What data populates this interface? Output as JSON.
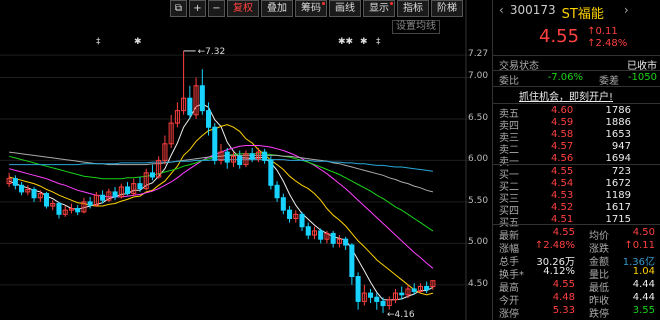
{
  "toolbar": {
    "buttons": [
      {
        "name": "export-button",
        "label": "⧉"
      },
      {
        "name": "zoom-in-button",
        "label": "+"
      },
      {
        "name": "zoom-out-button",
        "label": "−"
      },
      {
        "name": "adjust-button",
        "label": "复权",
        "active": true
      },
      {
        "name": "overlay-button",
        "label": "叠加"
      },
      {
        "name": "chips-button",
        "label": "筹码",
        "dot": true
      },
      {
        "name": "draw-button",
        "label": "画线"
      },
      {
        "name": "display-button",
        "label": "显示",
        "dot": true
      },
      {
        "name": "indicator-button",
        "label": "指标"
      },
      {
        "name": "ladder-button",
        "label": "阶梯"
      }
    ],
    "settings_label": "设置均线"
  },
  "price_axis": [
    "7.27",
    "7.00",
    "6.50",
    "6.00",
    "5.50",
    "5.00",
    "4.50"
  ],
  "annotations": {
    "high_label": "7.32",
    "low_label": "4.16",
    "markers": [
      "‡",
      "✱",
      "✱✱",
      "✱",
      "‡"
    ]
  },
  "stock": {
    "code": "300173",
    "name": "ST福能",
    "price": "4.55",
    "change": "↑0.11",
    "change_pct": "↑2.48%"
  },
  "trade_status": {
    "label": "交易状态",
    "value": "已收市"
  },
  "ratio": {
    "wei_bi_label": "委比",
    "wei_bi": "-7.06%",
    "wei_cha_label": "委差",
    "wei_cha": "-1050"
  },
  "promo": "抓住机会，即刻开户!",
  "asks": [
    {
      "label": "卖五",
      "price": "4.60",
      "vol": "1786"
    },
    {
      "label": "卖四",
      "price": "4.59",
      "vol": "1886"
    },
    {
      "label": "卖三",
      "price": "4.58",
      "vol": "1653"
    },
    {
      "label": "卖二",
      "price": "4.57",
      "vol": "947"
    },
    {
      "label": "卖一",
      "price": "4.56",
      "vol": "1694"
    }
  ],
  "bids": [
    {
      "label": "买一",
      "price": "4.55",
      "vol": "723"
    },
    {
      "label": "买二",
      "price": "4.54",
      "vol": "1672"
    },
    {
      "label": "买三",
      "price": "4.53",
      "vol": "1189"
    },
    {
      "label": "买四",
      "price": "4.52",
      "vol": "1617"
    },
    {
      "label": "买五",
      "price": "4.51",
      "vol": "1715"
    }
  ],
  "stats": [
    {
      "l1": "最新",
      "v1": "4.55",
      "c1": "red",
      "l2": "均价",
      "v2": "4.50",
      "c2": "red"
    },
    {
      "l1": "涨幅",
      "v1": "↑2.48%",
      "c1": "red",
      "l2": "涨跌",
      "v2": "↑0.11",
      "c2": "red"
    },
    {
      "l1": "总手",
      "v1": "30.26万",
      "c1": "white",
      "l2": "金额",
      "v2": "1.36亿",
      "c2": "cyan"
    },
    {
      "l1": "换手*",
      "v1": "4.12%",
      "c1": "white",
      "l2": "量比",
      "v2": "1.04",
      "c2": "yellow"
    },
    {
      "l1": "最高",
      "v1": "4.55",
      "c1": "red",
      "l2": "最低",
      "v2": "4.44",
      "c2": "white"
    },
    {
      "l1": "今开",
      "v1": "4.48",
      "c1": "red",
      "l2": "昨收",
      "v2": "4.44",
      "c2": "white"
    },
    {
      "l1": "涨停",
      "v1": "5.33",
      "c1": "red",
      "l2": "跌停",
      "v2": "3.55",
      "c2": "green"
    }
  ],
  "colors": {
    "up": "#ff4040",
    "down": "#19d3ff",
    "ma5": "#f0f0f0",
    "ma10": "#ffd200",
    "ma20": "#ff40ff",
    "ma30": "#19d319",
    "ma60": "#aaaaaa",
    "ma120": "#2aa7d8"
  },
  "chart_data": {
    "type": "candlestick",
    "ylim": [
      4.1,
      7.5
    ],
    "candles": [
      [
        5.72,
        5.78,
        5.85,
        5.68
      ],
      [
        5.78,
        5.7,
        5.82,
        5.65
      ],
      [
        5.7,
        5.62,
        5.74,
        5.58
      ],
      [
        5.62,
        5.65,
        5.7,
        5.58
      ],
      [
        5.65,
        5.55,
        5.68,
        5.5
      ],
      [
        5.55,
        5.6,
        5.64,
        5.5
      ],
      [
        5.6,
        5.45,
        5.62,
        5.42
      ],
      [
        5.45,
        5.48,
        5.52,
        5.4
      ],
      [
        5.48,
        5.35,
        5.5,
        5.3
      ],
      [
        5.35,
        5.4,
        5.45,
        5.32
      ],
      [
        5.4,
        5.42,
        5.48,
        5.36
      ],
      [
        5.42,
        5.38,
        5.46,
        5.34
      ],
      [
        5.38,
        5.5,
        5.55,
        5.36
      ],
      [
        5.5,
        5.46,
        5.56,
        5.42
      ],
      [
        5.46,
        5.58,
        5.62,
        5.44
      ],
      [
        5.58,
        5.52,
        5.64,
        5.48
      ],
      [
        5.52,
        5.62,
        5.66,
        5.5
      ],
      [
        5.62,
        5.56,
        5.68,
        5.52
      ],
      [
        5.56,
        5.68,
        5.72,
        5.54
      ],
      [
        5.68,
        5.6,
        5.74,
        5.58
      ],
      [
        5.6,
        5.72,
        5.78,
        5.58
      ],
      [
        5.72,
        5.66,
        5.8,
        5.62
      ],
      [
        5.66,
        5.85,
        5.9,
        5.64
      ],
      [
        5.85,
        5.8,
        5.95,
        5.76
      ],
      [
        5.8,
        6.0,
        6.05,
        5.78
      ],
      [
        6.0,
        6.2,
        6.3,
        5.95
      ],
      [
        6.2,
        6.45,
        6.55,
        6.15
      ],
      [
        6.45,
        6.6,
        6.7,
        6.4
      ],
      [
        6.6,
        6.75,
        7.32,
        6.55
      ],
      [
        6.75,
        6.55,
        6.9,
        6.5
      ],
      [
        6.55,
        6.9,
        7.0,
        6.5
      ],
      [
        6.9,
        6.6,
        7.1,
        6.55
      ],
      [
        6.6,
        6.4,
        6.7,
        6.3
      ],
      [
        6.4,
        6.0,
        6.45,
        5.95
      ],
      [
        6.0,
        6.1,
        6.2,
        5.95
      ],
      [
        6.1,
        5.98,
        6.15,
        5.9
      ],
      [
        5.98,
        6.05,
        6.1,
        5.92
      ],
      [
        6.05,
        5.95,
        6.12,
        5.9
      ],
      [
        5.95,
        6.08,
        6.12,
        5.92
      ],
      [
        6.08,
        6.02,
        6.15,
        5.98
      ],
      [
        6.02,
        6.1,
        6.15,
        5.98
      ],
      [
        6.1,
        6.0,
        6.14,
        5.96
      ],
      [
        6.0,
        5.7,
        6.05,
        5.65
      ],
      [
        5.7,
        5.55,
        5.75,
        5.5
      ],
      [
        5.55,
        5.4,
        5.6,
        5.35
      ],
      [
        5.4,
        5.3,
        5.45,
        5.25
      ],
      [
        5.3,
        5.35,
        5.4,
        5.25
      ],
      [
        5.35,
        5.2,
        5.38,
        5.15
      ],
      [
        5.2,
        5.1,
        5.25,
        5.05
      ],
      [
        5.1,
        5.15,
        5.2,
        5.05
      ],
      [
        5.15,
        5.05,
        5.18,
        5.0
      ],
      [
        5.05,
        5.12,
        5.15,
        5.0
      ],
      [
        5.12,
        5.0,
        5.15,
        4.95
      ],
      [
        5.0,
        5.05,
        5.1,
        4.95
      ],
      [
        5.05,
        4.98,
        5.08,
        4.92
      ],
      [
        4.98,
        4.6,
        5.0,
        4.5
      ],
      [
        4.6,
        4.3,
        4.65,
        4.2
      ],
      [
        4.3,
        4.4,
        4.5,
        4.25
      ],
      [
        4.4,
        4.35,
        4.45,
        4.28
      ],
      [
        4.35,
        4.3,
        4.4,
        4.2
      ],
      [
        4.3,
        4.25,
        4.35,
        4.16
      ],
      [
        4.25,
        4.32,
        4.36,
        4.2
      ],
      [
        4.32,
        4.4,
        4.45,
        4.28
      ],
      [
        4.4,
        4.38,
        4.48,
        4.32
      ],
      [
        4.38,
        4.45,
        4.5,
        4.34
      ],
      [
        4.45,
        4.42,
        4.52,
        4.38
      ],
      [
        4.42,
        4.48,
        4.52,
        4.4
      ],
      [
        4.48,
        4.44,
        4.54,
        4.4
      ],
      [
        4.48,
        4.55,
        4.55,
        4.44
      ]
    ],
    "ma": [
      {
        "name": "ma5",
        "values": [
          5.75,
          5.72,
          5.69,
          5.67,
          5.64,
          5.62,
          5.57,
          5.54,
          5.49,
          5.46,
          5.42,
          5.41,
          5.43,
          5.45,
          5.47,
          5.49,
          5.54,
          5.56,
          5.59,
          5.6,
          5.64,
          5.64,
          5.7,
          5.73,
          5.81,
          5.9,
          6.06,
          6.21,
          6.4,
          6.51,
          6.65,
          6.68,
          6.64,
          6.49,
          6.41,
          6.22,
          6.11,
          6.03,
          6.03,
          6.02,
          6.04,
          6.03,
          5.97,
          5.88,
          5.75,
          5.59,
          5.46,
          5.36,
          5.29,
          5.22,
          5.16,
          5.12,
          5.08,
          5.06,
          5.04,
          4.93,
          4.8,
          4.67,
          4.53,
          4.41,
          4.32,
          4.32,
          4.32,
          4.33,
          4.36,
          4.39,
          4.43,
          4.43,
          4.47
        ]
      },
      {
        "name": "ma10",
        "values": [
          5.8,
          5.78,
          5.76,
          5.74,
          5.72,
          5.69,
          5.65,
          5.62,
          5.58,
          5.55,
          5.52,
          5.49,
          5.48,
          5.46,
          5.45,
          5.45,
          5.47,
          5.48,
          5.51,
          5.53,
          5.56,
          5.57,
          5.62,
          5.64,
          5.7,
          5.75,
          5.84,
          5.93,
          6.06,
          6.13,
          6.23,
          6.3,
          6.36,
          6.38,
          6.41,
          6.43,
          6.4,
          6.35,
          6.26,
          6.21,
          6.13,
          6.07,
          6.0,
          5.95,
          5.89,
          5.81,
          5.75,
          5.7,
          5.66,
          5.6,
          5.52,
          5.42,
          5.34,
          5.28,
          5.21,
          5.12,
          5.03,
          4.96,
          4.88,
          4.8,
          4.74,
          4.68,
          4.62,
          4.56,
          4.5,
          4.44,
          4.4,
          4.38,
          4.4
        ]
      },
      {
        "name": "ma20",
        "values": [
          5.9,
          5.88,
          5.86,
          5.84,
          5.82,
          5.8,
          5.78,
          5.75,
          5.72,
          5.7,
          5.67,
          5.64,
          5.62,
          5.6,
          5.58,
          5.57,
          5.56,
          5.56,
          5.56,
          5.57,
          5.58,
          5.59,
          5.61,
          5.63,
          5.66,
          5.7,
          5.74,
          5.79,
          5.85,
          5.9,
          5.95,
          6.0,
          6.04,
          6.07,
          6.1,
          6.13,
          6.15,
          6.17,
          6.18,
          6.18,
          6.18,
          6.17,
          6.16,
          6.14,
          6.12,
          6.09,
          6.06,
          6.02,
          5.98,
          5.94,
          5.89,
          5.84,
          5.78,
          5.72,
          5.66,
          5.59,
          5.52,
          5.45,
          5.38,
          5.31,
          5.24,
          5.17,
          5.1,
          5.03,
          4.96,
          4.89,
          4.83,
          4.76,
          4.7
        ]
      },
      {
        "name": "ma30",
        "values": [
          6.05,
          6.03,
          6.01,
          5.99,
          5.97,
          5.95,
          5.93,
          5.91,
          5.89,
          5.87,
          5.85,
          5.83,
          5.81,
          5.8,
          5.79,
          5.78,
          5.78,
          5.78,
          5.78,
          5.79,
          5.79,
          5.8,
          5.81,
          5.82,
          5.84,
          5.86,
          5.88,
          5.9,
          5.93,
          5.95,
          5.97,
          6.0,
          6.02,
          6.04,
          6.05,
          6.06,
          6.07,
          6.08,
          6.08,
          6.08,
          6.08,
          6.08,
          6.07,
          6.06,
          6.05,
          6.04,
          6.02,
          6.0,
          5.98,
          5.95,
          5.92,
          5.89,
          5.86,
          5.83,
          5.79,
          5.75,
          5.71,
          5.67,
          5.63,
          5.58,
          5.54,
          5.49,
          5.44,
          5.4,
          5.35,
          5.3,
          5.25,
          5.2,
          5.15
        ]
      },
      {
        "name": "ma60",
        "values": [
          6.1,
          6.09,
          6.08,
          6.07,
          6.06,
          6.05,
          6.04,
          6.03,
          6.02,
          6.01,
          6.0,
          5.99,
          5.98,
          5.97,
          5.96,
          5.96,
          5.95,
          5.95,
          5.95,
          5.95,
          5.95,
          5.95,
          5.95,
          5.96,
          5.96,
          5.97,
          5.98,
          5.99,
          6.0,
          6.01,
          6.02,
          6.03,
          6.04,
          6.05,
          6.05,
          6.06,
          6.06,
          6.06,
          6.06,
          6.06,
          6.06,
          6.06,
          6.06,
          6.06,
          6.05,
          6.05,
          6.04,
          6.03,
          6.02,
          6.01,
          6.0,
          5.99,
          5.97,
          5.96,
          5.94,
          5.92,
          5.9,
          5.88,
          5.86,
          5.84,
          5.82,
          5.79,
          5.77,
          5.74,
          5.72,
          5.69,
          5.67,
          5.64,
          5.62
        ]
      },
      {
        "name": "ma120",
        "values": [
          5.95,
          5.95,
          5.95,
          5.95,
          5.95,
          5.95,
          5.95,
          5.95,
          5.95,
          5.95,
          5.95,
          5.95,
          5.96,
          5.96,
          5.96,
          5.96,
          5.96,
          5.96,
          5.97,
          5.97,
          5.97,
          5.97,
          5.97,
          5.98,
          5.98,
          5.98,
          5.98,
          5.99,
          5.99,
          5.99,
          6.0,
          6.0,
          6.0,
          6.01,
          6.01,
          6.01,
          6.01,
          6.01,
          6.01,
          6.01,
          6.01,
          6.01,
          6.01,
          6.01,
          6.01,
          6.0,
          6.0,
          6.0,
          6.0,
          5.99,
          5.99,
          5.99,
          5.98,
          5.98,
          5.97,
          5.97,
          5.96,
          5.96,
          5.95,
          5.94,
          5.94,
          5.93,
          5.92,
          5.92,
          5.91,
          5.9,
          5.89,
          5.88,
          5.87
        ]
      }
    ]
  }
}
